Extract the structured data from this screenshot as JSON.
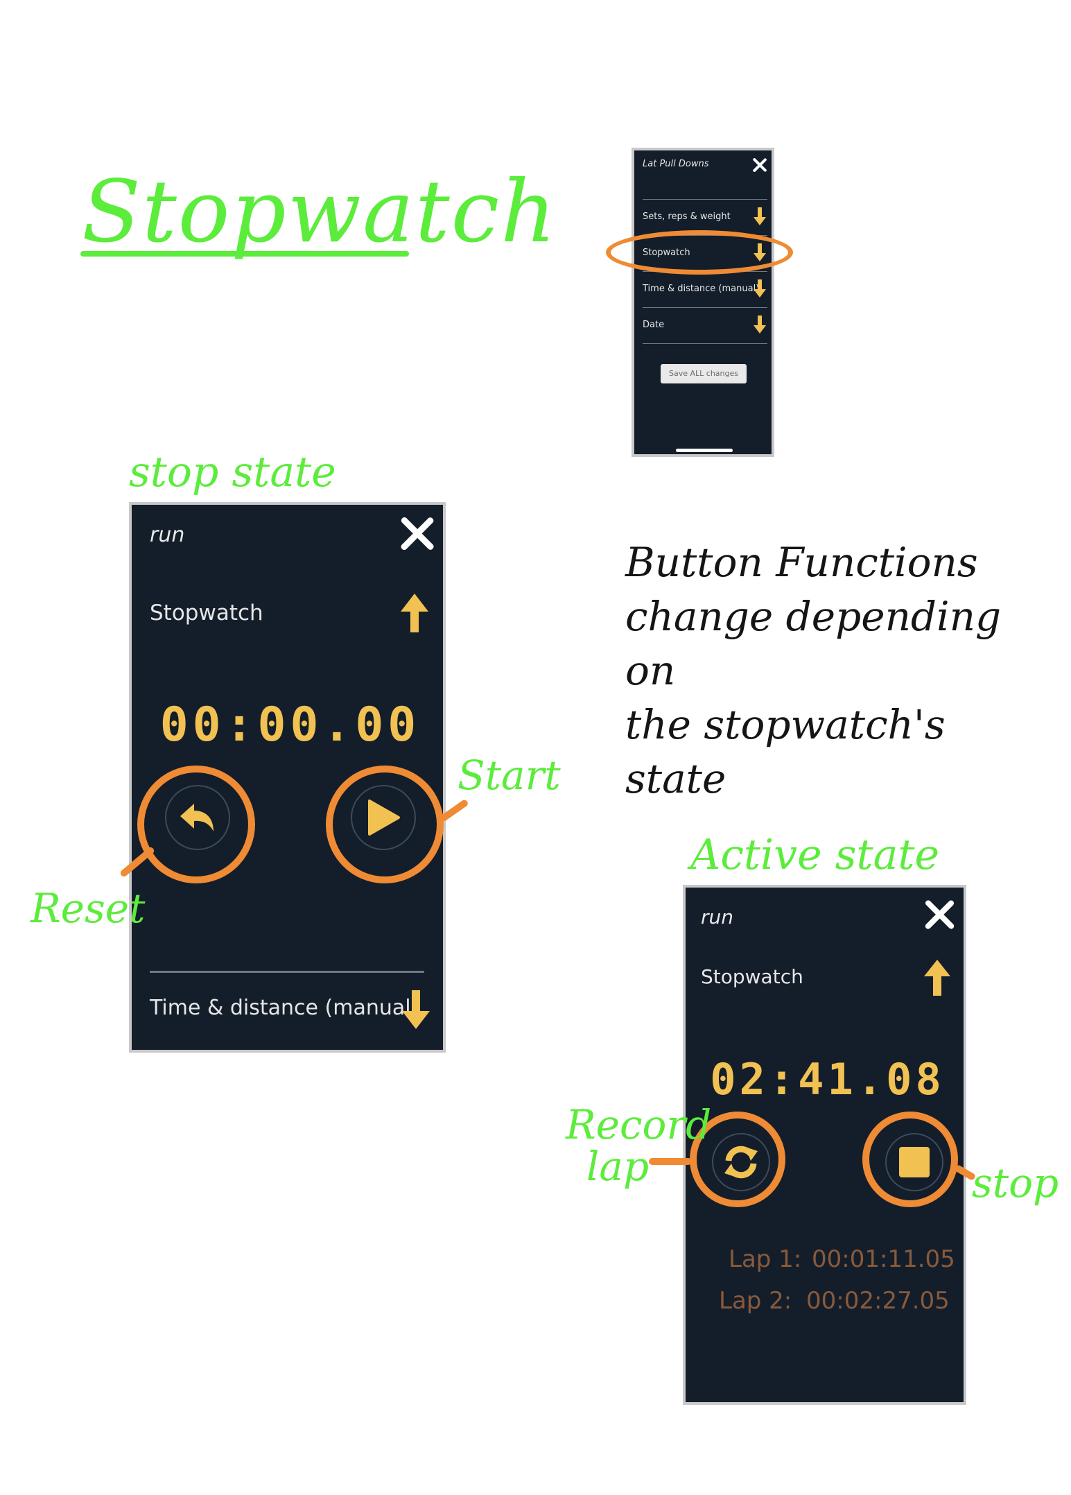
{
  "page_title": "Stopwatch",
  "colors": {
    "annotation_green": "#5cec3c",
    "highlight_orange": "#ef8b34",
    "accent_yellow": "#f1c152",
    "panel_bg": "#141e2b"
  },
  "labels": {
    "stop_state": "stop state",
    "active_state": "Active state",
    "note_lines": [
      "Button Functions",
      "change depending on",
      "the stopwatch's state"
    ],
    "start": "Start",
    "reset": "Reset",
    "record_lap": [
      "Record",
      "lap"
    ],
    "stop": "stop"
  },
  "menu_phone": {
    "title": "Lat Pull Downs",
    "items": [
      {
        "label": "Sets, reps & weight",
        "icon": "arrow-down-icon"
      },
      {
        "label": "Stopwatch",
        "icon": "arrow-down-icon"
      },
      {
        "label": "Time & distance (manual)",
        "icon": "arrow-down-icon"
      },
      {
        "label": "Date",
        "icon": "arrow-down-icon"
      }
    ],
    "save_label": "Save ALL changes"
  },
  "stop_phone": {
    "exercise": "run",
    "section": "Stopwatch",
    "time": "00:00.00",
    "next_section": "Time & distance (manual)"
  },
  "active_phone": {
    "exercise": "run",
    "section": "Stopwatch",
    "time": "02:41.08",
    "laps": [
      {
        "label": "Lap 1:",
        "time": "00:01:11.05"
      },
      {
        "label": "Lap 2:",
        "time": "00:02:27.05"
      }
    ]
  }
}
